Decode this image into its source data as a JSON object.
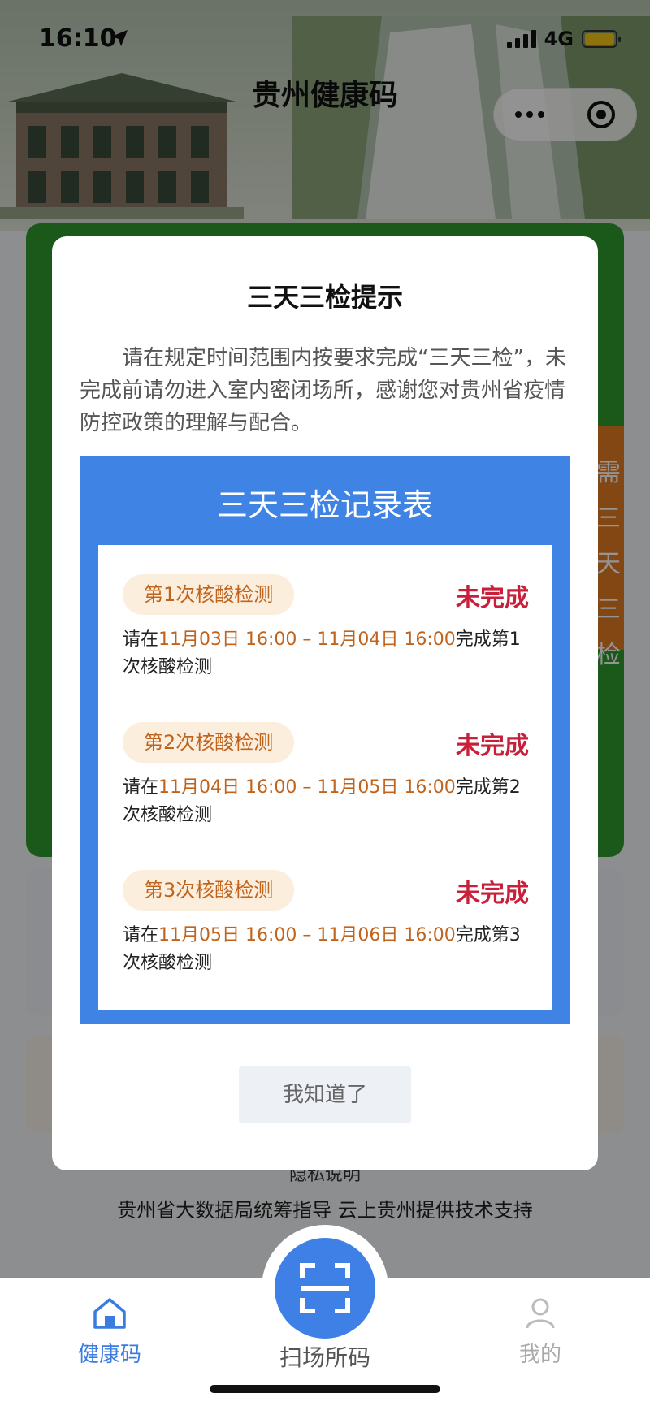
{
  "status_bar": {
    "time": "16:10",
    "network": "4G"
  },
  "header": {
    "title": "贵州健康码"
  },
  "background": {
    "side_tab_text": "需三天三检",
    "privacy": "隐私说明",
    "footer": "贵州省大数据局统筹指导 云上贵州提供技术支持"
  },
  "modal": {
    "title": "三天三检提示",
    "description": "请在规定时间范围内按要求完成“三天三检”，未完成前请勿进入室内密闭场所，感谢您对贵州省疫情防控政策的理解与配合。",
    "record_title": "三天三检记录表",
    "items": [
      {
        "label": "第1次核酸检测",
        "status": "未完成",
        "prefix": "请在",
        "range": "11月03日 16:00 – 11月04日 16:00",
        "suffix": "完成第1次核酸检测"
      },
      {
        "label": "第2次核酸检测",
        "status": "未完成",
        "prefix": "请在",
        "range": "11月04日 16:00 – 11月05日 16:00",
        "suffix": "完成第2次核酸检测"
      },
      {
        "label": "第3次核酸检测",
        "status": "未完成",
        "prefix": "请在",
        "range": "11月05日 16:00 – 11月06日 16:00",
        "suffix": "完成第3次核酸检测"
      }
    ],
    "confirm_label": "我知道了"
  },
  "tabbar": {
    "health_label": "健康码",
    "scan_label": "扫场所码",
    "mine_label": "我的"
  },
  "colors": {
    "accent": "#3f80e6",
    "warning": "#c8203a",
    "highlight": "#c0641d",
    "green_card": "#2e9a2b"
  }
}
